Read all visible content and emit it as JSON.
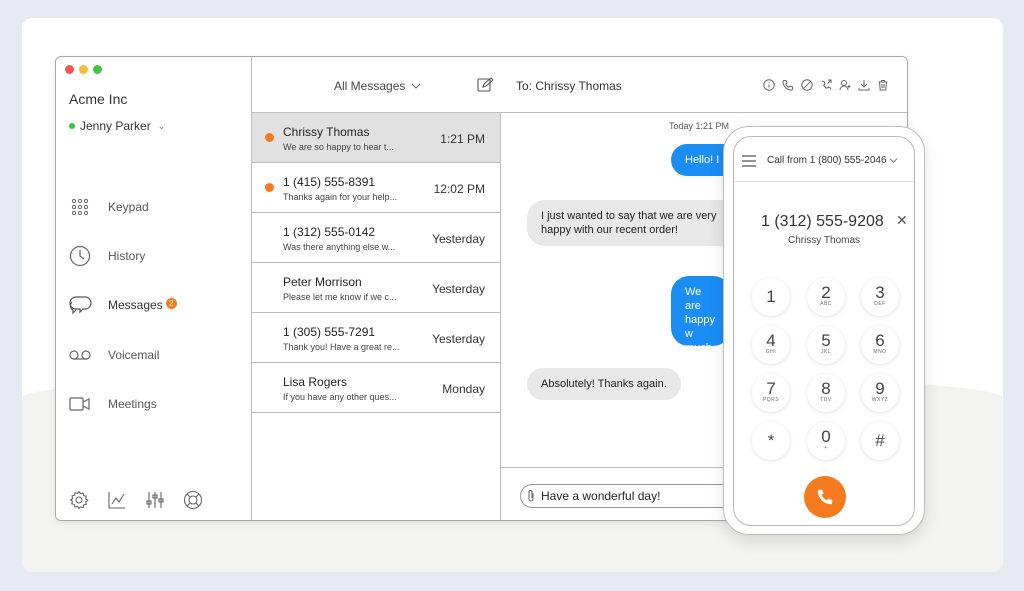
{
  "window": {
    "dot_colors": [
      "#ee5a52",
      "#f5be33",
      "#3ec744"
    ]
  },
  "sidebar": {
    "company": "Acme Inc",
    "user": "Jenny Parker",
    "nav": [
      {
        "label": "Keypad",
        "icon": "keypad-icon"
      },
      {
        "label": "History",
        "icon": "clock-icon"
      },
      {
        "label": "Messages",
        "icon": "chat-bubbles-icon",
        "badge": "2"
      },
      {
        "label": "Voicemail",
        "icon": "voicemail-icon"
      },
      {
        "label": "Meetings",
        "icon": "video-camera-icon"
      }
    ],
    "footer_icons": [
      "gear-icon",
      "analytics-icon",
      "sliders-icon",
      "help-lifebuoy-icon"
    ]
  },
  "header": {
    "filter": "All Messages",
    "to": "To: Chrissy  Thomas",
    "actions": [
      "info-icon",
      "phone-icon",
      "block-icon",
      "call-forward-icon",
      "add-contact-icon",
      "download-icon",
      "trash-icon"
    ]
  },
  "conversations": [
    {
      "name": "Chrissy Thomas",
      "preview": "We are so happy to hear t...",
      "time": "1:21 PM",
      "unread": true,
      "active": true
    },
    {
      "name": "1 (415) 555-8391",
      "preview": "Thanks again for your help...",
      "time": "12:02 PM",
      "unread": true,
      "active": false
    },
    {
      "name": "1 (312) 555-0142",
      "preview": "Was there anything else w...",
      "time": "Yesterday",
      "unread": false,
      "active": false
    },
    {
      "name": "Peter Morrison",
      "preview": "Please let me know if we c...",
      "time": "Yesterday",
      "unread": false,
      "active": false
    },
    {
      "name": "1 (305) 555-7291",
      "preview": "Thank you! Have a great re...",
      "time": "Yesterday",
      "unread": false,
      "active": false
    },
    {
      "name": "Lisa Rogers",
      "preview": "If you have any other ques...",
      "time": "Monday",
      "unread": false,
      "active": false
    }
  ],
  "thread": {
    "timestamp": "Today 1:21 PM",
    "messages": [
      {
        "text": "Hello! I",
        "dir": "out"
      },
      {
        "text": "I just wanted to say that we are very happy with our recent order!",
        "dir": "in"
      },
      {
        "text": "We are happy w much fo your fee",
        "dir": "out"
      },
      {
        "text": "Absolutely! Thanks again.",
        "dir": "in"
      }
    ],
    "draft": "Have a wonderful day!"
  },
  "dialer": {
    "call_from": "Call from 1 (800) 555-2046",
    "number": "1 (312) 555-9208",
    "contact": "Chrissy  Thomas",
    "keys": [
      {
        "d": "1",
        "l": ""
      },
      {
        "d": "2",
        "l": "ABC"
      },
      {
        "d": "3",
        "l": "DEF"
      },
      {
        "d": "4",
        "l": "GHI"
      },
      {
        "d": "5",
        "l": "JKL"
      },
      {
        "d": "6",
        "l": "MNO"
      },
      {
        "d": "7",
        "l": "PQRS"
      },
      {
        "d": "8",
        "l": "TUV"
      },
      {
        "d": "9",
        "l": "WXYZ"
      },
      {
        "d": "*",
        "l": ""
      },
      {
        "d": "0",
        "l": "+"
      },
      {
        "d": "#",
        "l": ""
      }
    ],
    "call_color": "#f47b20"
  },
  "colors": {
    "accent": "#f47b20",
    "bubble_out": "#1a8ef5",
    "online": "#2ecc40"
  }
}
